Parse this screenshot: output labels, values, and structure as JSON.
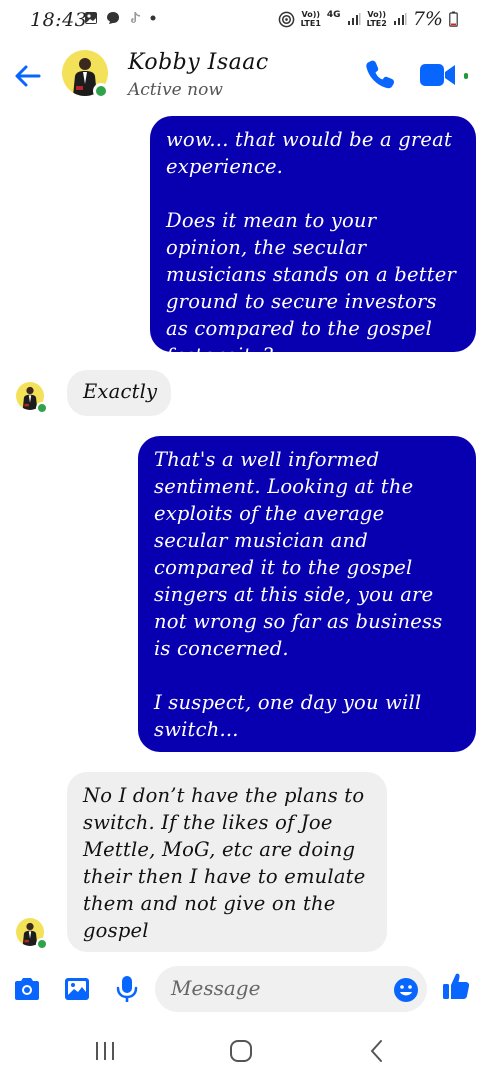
{
  "status_bar": {
    "time": "18:43",
    "sim1_label": "Vo))",
    "sim1_sub": "LTE1",
    "network_type": "4G",
    "sim2_label": "Vo))",
    "sim2_sub": "LTE2",
    "battery": "7%"
  },
  "header": {
    "contact_name": "Kobby Isaac",
    "status": "Active now"
  },
  "messages": [
    {
      "direction": "outgoing",
      "text": "wow... that would be a great experience.\n\nDoes it mean to your opinion, the secular musicians stands on a better ground to secure investors as compared to the gospel fraternity?"
    },
    {
      "direction": "incoming",
      "text": "Exactly"
    },
    {
      "direction": "outgoing",
      "text": "That's a well informed sentiment. Looking at the exploits of the average secular musician and compared it to the gospel singers at this side, you are not wrong so far as business is concerned.\n\nI suspect, one day you will switch..."
    },
    {
      "direction": "incoming",
      "text": "No I don’t have the plans to switch. If the likes of Joe Mettle, MoG, etc are doing their then I have to emulate them and not give on the gospel"
    }
  ],
  "composer": {
    "placeholder": "Message"
  },
  "colors": {
    "accent": "#0866ff",
    "outgoing_bubble": "#0800b0",
    "incoming_bubble": "#efefef",
    "online": "#31a24c",
    "avatar_bg": "#f4e15a"
  },
  "icons": {
    "back": "back-arrow-icon",
    "call": "phone-icon",
    "video": "video-camera-icon",
    "camera": "camera-icon",
    "gallery": "image-icon",
    "mic": "microphone-icon",
    "emoji": "emoji-icon",
    "like": "thumbs-up-icon"
  }
}
